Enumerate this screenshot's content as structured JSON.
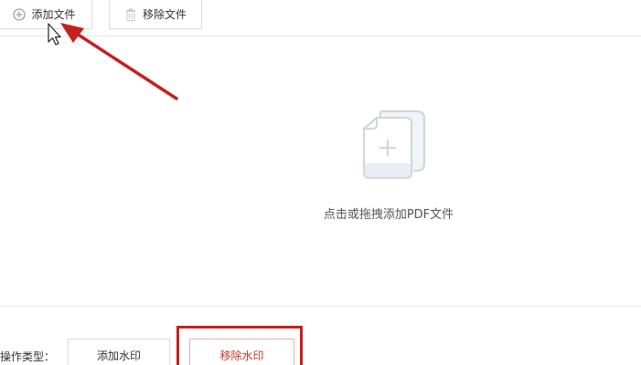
{
  "toolbar": {
    "add_file_label": "添加文件",
    "remove_file_label": "移除文件"
  },
  "dropzone": {
    "hint": "点击或拖拽添加PDF文件"
  },
  "operation": {
    "type_label": "操作类型：",
    "options": [
      "添加水印",
      "移除水印"
    ],
    "selected": "移除水印"
  },
  "colors": {
    "accent_red": "#c62020",
    "border": "#dcdcdc",
    "icon_gray": "#d2d6de"
  },
  "icons": {
    "add": "plus-circle-icon",
    "remove": "trash-icon",
    "file": "file-copy-add-icon",
    "cursor": "mouse-cursor-icon"
  }
}
